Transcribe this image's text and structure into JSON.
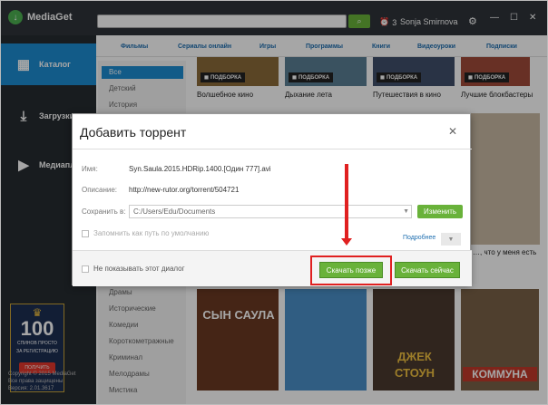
{
  "app": {
    "title": "MediaGet"
  },
  "topbar": {
    "search_placeholder": "",
    "notif_count": "3",
    "user": "Sonja Smirnova",
    "win_controls": [
      "—",
      "☐",
      "✕"
    ]
  },
  "sidebar": {
    "items": [
      {
        "label": "Каталог",
        "icon": "catalog-icon"
      },
      {
        "label": "Загрузки",
        "icon": "download-icon"
      },
      {
        "label": "Медиапл",
        "icon": "play-icon"
      }
    ],
    "banner": {
      "number": "100",
      "line1": "СПИНОВ ПРОСТО",
      "line2": "ЗА РЕГИСТРАЦИЮ",
      "button": "ПОЛУЧИТЬ"
    },
    "copyright": [
      "Copyright © 2015 MediaGet",
      "Все права защищены",
      "Версия: 2.01.3617"
    ]
  },
  "tabs": [
    "Фильмы",
    "Сериалы онлайн",
    "Игры",
    "Программы",
    "Книги",
    "Видеоуроки",
    "Подписки"
  ],
  "categories_top": [
    "Все",
    "Детский",
    "История"
  ],
  "categories_bottom": [
    "Драмы",
    "Исторические",
    "Комедии",
    "Короткометражные",
    "Криминал",
    "Мелодрамы",
    "Мистика"
  ],
  "poster_label": "ПОДБОРКА",
  "top_posters": [
    "Волшебное кино",
    "Дыхание лета",
    "Путешествия в кино",
    "Лучшие блокбастеры"
  ],
  "side_poster_caption": "…, что у меня есть",
  "bottom_posters": [
    "СЫН САУЛА",
    "",
    "ДЖЕК СТОУН",
    "КОММУНА"
  ],
  "dialog": {
    "title": "Добавить торрент",
    "name_label": "Имя:",
    "name_value": "Syn.Saula.2015.HDRip.1400.[Один 777].avi",
    "desc_label": "Описание:",
    "desc_value": "http://new-rutor.org/torrent/504721",
    "save_label": "Сохранить в:",
    "save_path": "C:/Users/Edu/Documents",
    "change_btn": "Изменить",
    "remember_label": "Запомнить как путь по умолчанию",
    "more_link": "Подробнее",
    "noshow_label": "Не показывать этот диалог",
    "later_btn": "Скачать позже",
    "now_btn": "Скачать сейчас"
  }
}
